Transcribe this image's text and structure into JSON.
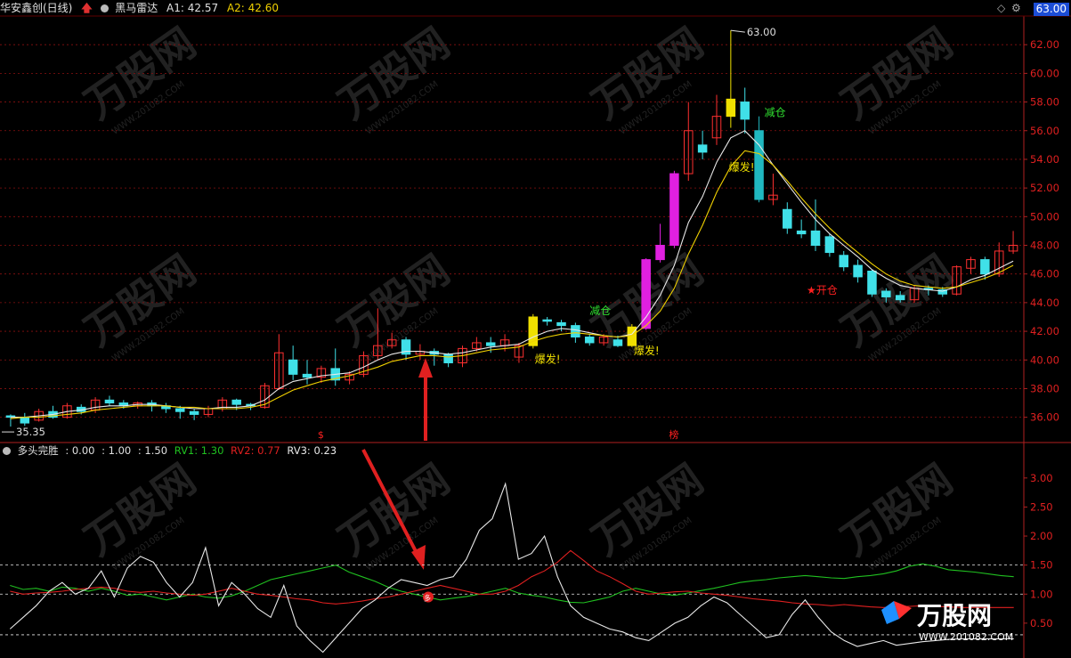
{
  "header": {
    "stock_name": "华安鑫创(日线)",
    "indicator_name": "黑马雷达",
    "a1_label": "A1: 42.57",
    "a2_label": "A2: 42.60",
    "current_price": "63.00",
    "colors": {
      "a1": "#e0e0e0",
      "a2": "#f0d000",
      "stock": "#e0e0e0"
    }
  },
  "main_chart": {
    "y_ticks": [
      "62.00",
      "60.00",
      "58.00",
      "56.00",
      "54.00",
      "52.00",
      "50.00",
      "48.00",
      "46.00",
      "44.00",
      "42.00",
      "40.00",
      "38.00",
      "36.00"
    ],
    "ylim": [
      34.3,
      64.0
    ],
    "high_label": "63.00",
    "low_label": "35.35",
    "markers": {
      "baofa_1": "爆发!",
      "baofa_2": "爆发!",
      "baofa_3": "爆发!",
      "jiancang_1": "减仓",
      "jiancang_2": "减仓",
      "kaicang": "★开仓",
      "bottom_s": "$",
      "bottom_bang": "榜"
    },
    "watermark": "万股网",
    "watermark_url": "WWW.201082.COM"
  },
  "chart_data": [
    {
      "type": "candlestick",
      "x_count": 72,
      "candles": [
        [
          36.1,
          36.0,
          35.35,
          36.2
        ],
        [
          36.0,
          35.6,
          35.4,
          36.3
        ],
        [
          35.8,
          36.4,
          35.7,
          36.6
        ],
        [
          36.4,
          36.0,
          35.9,
          36.8
        ],
        [
          36.0,
          36.8,
          35.9,
          37.0
        ],
        [
          36.7,
          36.4,
          36.2,
          36.9
        ],
        [
          36.5,
          37.2,
          36.3,
          37.4
        ],
        [
          37.2,
          37.0,
          36.8,
          37.5
        ],
        [
          37.0,
          36.8,
          36.6,
          37.2
        ],
        [
          36.8,
          37.0,
          36.6,
          37.1
        ],
        [
          37.0,
          36.8,
          36.4,
          37.2
        ],
        [
          36.8,
          36.6,
          36.3,
          37.0
        ],
        [
          36.6,
          36.4,
          35.9,
          36.8
        ],
        [
          36.4,
          36.2,
          35.8,
          36.6
        ],
        [
          36.2,
          36.6,
          36.0,
          36.8
        ],
        [
          36.6,
          37.2,
          36.4,
          37.4
        ],
        [
          37.2,
          36.9,
          36.5,
          37.3
        ],
        [
          36.9,
          36.8,
          36.5,
          37.0
        ],
        [
          36.7,
          38.2,
          36.6,
          38.4
        ],
        [
          38.0,
          40.5,
          37.9,
          41.8
        ],
        [
          40.0,
          39.0,
          38.6,
          41.0
        ],
        [
          39.0,
          38.8,
          38.3,
          40.0
        ],
        [
          38.8,
          39.4,
          38.4,
          39.6
        ],
        [
          39.4,
          38.6,
          38.2,
          40.8
        ],
        [
          38.6,
          39.0,
          38.3,
          39.2
        ],
        [
          39.0,
          40.3,
          38.8,
          40.6
        ],
        [
          40.3,
          41.0,
          40.0,
          43.6
        ],
        [
          41.0,
          41.4,
          40.8,
          41.9
        ],
        [
          41.4,
          40.4,
          40.0,
          41.6
        ],
        [
          40.4,
          40.6,
          40.0,
          41.1
        ],
        [
          40.6,
          40.4,
          39.6,
          40.8
        ],
        [
          40.4,
          39.8,
          39.5,
          40.5
        ],
        [
          39.8,
          40.8,
          39.5,
          41.0
        ],
        [
          40.8,
          41.2,
          40.6,
          41.6
        ],
        [
          41.2,
          41.0,
          40.5,
          41.6
        ],
        [
          41.0,
          41.4,
          40.6,
          41.8
        ],
        [
          40.2,
          41.0,
          39.8,
          41.2
        ],
        [
          41.0,
          43.0,
          40.8,
          43.2
        ],
        [
          42.8,
          42.7,
          42.4,
          43.0
        ],
        [
          42.6,
          42.4,
          42.0,
          42.8
        ],
        [
          42.4,
          41.6,
          41.2,
          42.6
        ],
        [
          41.6,
          41.2,
          41.0,
          41.8
        ],
        [
          41.2,
          41.6,
          41.0,
          41.8
        ],
        [
          41.4,
          41.0,
          40.9,
          41.7
        ],
        [
          41.0,
          42.3,
          40.9,
          42.5
        ],
        [
          42.2,
          47.0,
          42.1,
          47.1
        ],
        [
          47.0,
          48.0,
          46.8,
          49.5
        ],
        [
          48.0,
          53.0,
          47.8,
          53.2
        ],
        [
          53.0,
          56.0,
          52.5,
          58.0
        ],
        [
          55.0,
          54.5,
          54.0,
          56.0
        ],
        [
          55.5,
          57.0,
          55.0,
          58.5
        ],
        [
          57.0,
          58.2,
          56.2,
          63.0
        ],
        [
          58.0,
          56.8,
          55.8,
          59.0
        ],
        [
          56.0,
          51.2,
          51.0,
          57.0
        ],
        [
          51.2,
          51.5,
          50.8,
          53.0
        ],
        [
          50.5,
          49.2,
          48.8,
          51.0
        ],
        [
          49.0,
          48.8,
          48.5,
          49.8
        ],
        [
          49.0,
          48.0,
          47.6,
          51.2
        ],
        [
          48.6,
          47.5,
          47.2,
          48.8
        ],
        [
          47.3,
          46.5,
          46.2,
          47.6
        ],
        [
          46.6,
          45.8,
          45.4,
          47.0
        ],
        [
          46.2,
          44.6,
          44.4,
          46.3
        ],
        [
          44.8,
          44.4,
          44.0,
          45.0
        ],
        [
          44.5,
          44.2,
          44.0,
          44.8
        ],
        [
          44.2,
          45.0,
          44.0,
          45.2
        ],
        [
          45.0,
          44.9,
          44.5,
          45.2
        ],
        [
          44.9,
          44.6,
          44.4,
          45.1
        ],
        [
          44.6,
          46.5,
          44.5,
          46.6
        ],
        [
          46.4,
          47.0,
          46.0,
          47.2
        ],
        [
          47.0,
          46.0,
          45.6,
          47.2
        ],
        [
          46.0,
          47.6,
          45.8,
          48.2
        ],
        [
          47.6,
          48.0,
          47.4,
          49.0
        ]
      ],
      "ma_white": [
        36.0,
        36.0,
        36.1,
        36.2,
        36.4,
        36.5,
        36.7,
        36.8,
        36.8,
        36.9,
        36.9,
        36.8,
        36.7,
        36.6,
        36.6,
        36.7,
        36.7,
        36.8,
        37.2,
        38.0,
        38.5,
        38.7,
        38.9,
        39.0,
        39.1,
        39.5,
        40.0,
        40.4,
        40.6,
        40.6,
        40.5,
        40.4,
        40.5,
        40.7,
        40.9,
        41.0,
        41.1,
        41.6,
        42.0,
        42.2,
        42.1,
        41.9,
        41.7,
        41.6,
        41.8,
        43.0,
        44.5,
        46.6,
        49.6,
        51.4,
        53.8,
        55.5,
        56.0,
        55.0,
        53.6,
        52.3,
        51.0,
        49.8,
        48.8,
        48.0,
        47.2,
        46.3,
        45.7,
        45.2,
        45.0,
        44.9,
        44.8,
        45.1,
        45.6,
        45.9,
        46.4,
        46.9
      ],
      "ma_yellow": [
        35.9,
        36.0,
        36.0,
        36.1,
        36.2,
        36.3,
        36.5,
        36.6,
        36.7,
        36.8,
        36.8,
        36.8,
        36.7,
        36.7,
        36.6,
        36.6,
        36.6,
        36.7,
        36.9,
        37.4,
        37.9,
        38.2,
        38.5,
        38.7,
        38.9,
        39.2,
        39.5,
        39.9,
        40.1,
        40.3,
        40.3,
        40.2,
        40.3,
        40.5,
        40.7,
        40.8,
        40.9,
        41.3,
        41.6,
        41.8,
        41.9,
        41.8,
        41.7,
        41.6,
        41.7,
        42.4,
        43.4,
        45.0,
        47.4,
        49.4,
        51.7,
        53.5,
        54.6,
        54.4,
        53.6,
        52.5,
        51.3,
        50.2,
        49.2,
        48.3,
        47.5,
        46.7,
        46.0,
        45.5,
        45.2,
        45.1,
        45.0,
        45.1,
        45.4,
        45.7,
        46.1,
        46.6
      ]
    },
    {
      "type": "line",
      "title": "多头完胜",
      "params": [
        ": 0.00",
        ": 1.00",
        ": 1.50"
      ],
      "series": [
        {
          "name": "RV1: 1.30",
          "color": "#20c020"
        },
        {
          "name": "RV2: 0.77",
          "color": "#e02020"
        },
        {
          "name": "RV3: 0.23",
          "color": "#e8e8e8"
        }
      ],
      "y_ticks": [
        "3.00",
        "2.50",
        "2.00",
        "1.50",
        "1.00",
        "0.50"
      ],
      "ylim": [
        -0.1,
        3.35
      ],
      "ref_lines": [
        0.3,
        1.0,
        1.5
      ],
      "rv1": [
        1.15,
        1.08,
        1.1,
        1.05,
        1.12,
        1.1,
        1.05,
        1.1,
        1.05,
        0.98,
        1.0,
        0.95,
        0.9,
        0.95,
        1.0,
        0.95,
        0.93,
        0.97,
        1.05,
        1.15,
        1.25,
        1.3,
        1.35,
        1.4,
        1.45,
        1.5,
        1.38,
        1.3,
        1.22,
        1.12,
        1.05,
        1.0,
        0.95,
        0.9,
        0.93,
        0.96,
        1.0,
        1.05,
        1.1,
        1.02,
        0.98,
        0.95,
        0.9,
        0.86,
        0.85,
        0.9,
        0.95,
        1.05,
        1.1,
        1.05,
        1.0,
        0.98,
        1.02,
        1.06,
        1.1,
        1.15,
        1.2,
        1.23,
        1.25,
        1.28,
        1.3,
        1.32,
        1.3,
        1.28,
        1.27,
        1.3,
        1.32,
        1.35,
        1.4,
        1.48,
        1.52,
        1.48,
        1.42,
        1.4,
        1.38,
        1.35,
        1.32,
        1.3
      ],
      "rv2": [
        1.05,
        1.0,
        1.02,
        1.03,
        1.05,
        1.08,
        1.1,
        1.12,
        1.1,
        1.05,
        1.03,
        1.05,
        1.02,
        1.0,
        0.98,
        1.0,
        1.05,
        1.1,
        1.05,
        1.0,
        0.98,
        0.95,
        0.92,
        0.9,
        0.85,
        0.83,
        0.85,
        0.88,
        0.92,
        0.95,
        1.0,
        1.05,
        1.1,
        1.15,
        1.1,
        1.05,
        1.0,
        1.0,
        1.05,
        1.15,
        1.3,
        1.4,
        1.55,
        1.75,
        1.58,
        1.4,
        1.3,
        1.18,
        1.05,
        1.0,
        1.02,
        1.04,
        1.05,
        1.02,
        1.0,
        0.98,
        0.95,
        0.92,
        0.9,
        0.88,
        0.85,
        0.83,
        0.82,
        0.8,
        0.82,
        0.8,
        0.78,
        0.77,
        0.78,
        0.79,
        0.8,
        0.79,
        0.78,
        0.77,
        0.77,
        0.77,
        0.77,
        0.77
      ],
      "rv3": [
        0.4,
        0.6,
        0.8,
        1.05,
        1.2,
        1.0,
        1.1,
        1.4,
        0.95,
        1.45,
        1.65,
        1.55,
        1.2,
        0.95,
        1.2,
        1.8,
        0.8,
        1.2,
        1.0,
        0.75,
        0.6,
        1.15,
        0.45,
        0.2,
        0.0,
        0.25,
        0.5,
        0.75,
        0.9,
        1.1,
        1.25,
        1.2,
        1.15,
        1.25,
        1.3,
        1.6,
        2.1,
        2.3,
        2.9,
        1.6,
        1.7,
        2.0,
        1.3,
        0.8,
        0.6,
        0.5,
        0.4,
        0.35,
        0.25,
        0.2,
        0.35,
        0.5,
        0.6,
        0.8,
        0.95,
        0.85,
        0.65,
        0.45,
        0.25,
        0.3,
        0.65,
        0.9,
        0.6,
        0.35,
        0.2,
        0.1,
        0.15,
        0.2,
        0.12,
        0.15,
        0.18,
        0.2,
        0.22,
        0.23,
        0.23,
        0.23,
        0.23,
        0.23
      ]
    }
  ]
}
